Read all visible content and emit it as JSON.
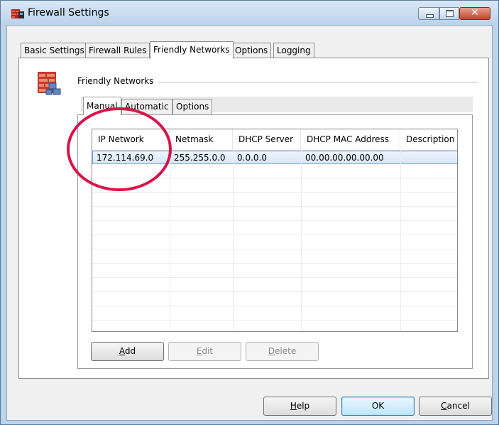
{
  "window": {
    "title": "Firewall Settings"
  },
  "tabs": [
    {
      "label": "Basic Settings"
    },
    {
      "label": "Firewall Rules"
    },
    {
      "label": "Friendly Networks"
    },
    {
      "label": "Options"
    },
    {
      "label": "Logging"
    }
  ],
  "section": {
    "label": "Friendly Networks"
  },
  "inner_tabs": [
    {
      "label": "Manual"
    },
    {
      "label": "Automatic"
    },
    {
      "label": "Options"
    }
  ],
  "table": {
    "columns": [
      "IP Network",
      "Netmask",
      "DHCP Server",
      "DHCP MAC Address",
      "Description"
    ],
    "rows": [
      [
        "172.114.69.0",
        "255.255.0.0",
        "0.0.0.0",
        "00.00.00.00.00.00",
        ""
      ]
    ]
  },
  "list_buttons": {
    "add": {
      "pre": "",
      "key": "A",
      "post": "dd"
    },
    "edit": {
      "pre": "",
      "key": "E",
      "post": "dit"
    },
    "delete": {
      "pre": "",
      "key": "D",
      "post": "elete"
    }
  },
  "dialog_buttons": {
    "help": {
      "pre": "",
      "key": "H",
      "post": "elp"
    },
    "ok": {
      "label": "OK"
    },
    "cancel": {
      "pre": "",
      "key": "C",
      "post": "ancel"
    }
  },
  "colors": {
    "annotation": "#d8154a",
    "selection": "#d6e7f8"
  }
}
